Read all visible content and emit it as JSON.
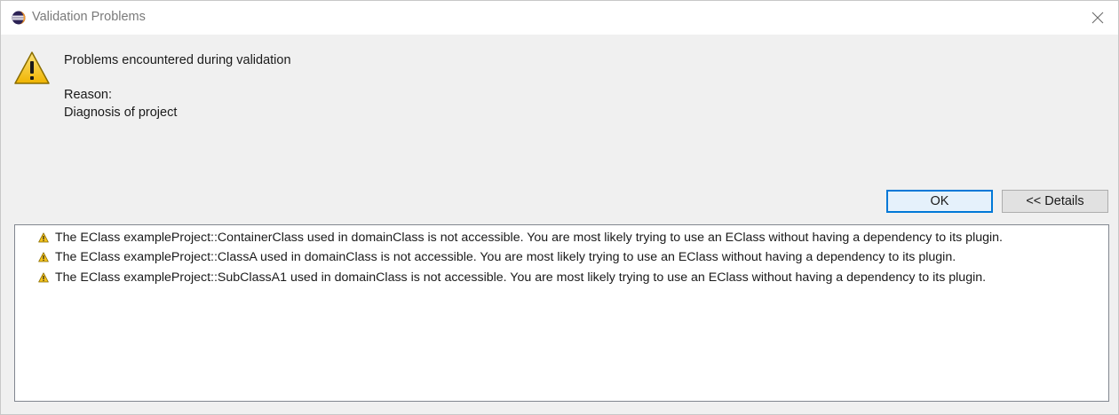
{
  "window": {
    "title": "Validation Problems",
    "close_label": "×"
  },
  "message": {
    "title": "Problems encountered during validation",
    "reason_label": "Reason:",
    "reason_detail": "Diagnosis of project",
    "icon": "warning-icon"
  },
  "buttons": {
    "ok_label": "OK",
    "details_label": "<< Details"
  },
  "details": {
    "items": [
      {
        "icon": "warning-icon",
        "text": "The EClass exampleProject::ContainerClass used in domainClass is not accessible. You are most likely trying to use an EClass without having a dependency to its plugin."
      },
      {
        "icon": "warning-icon",
        "text": "The EClass exampleProject::ClassA used in domainClass is not accessible. You are most likely trying to use an EClass without having a dependency to its plugin."
      },
      {
        "icon": "warning-icon",
        "text": "The EClass exampleProject::SubClassA1 used in domainClass is not accessible. You are most likely trying to use an EClass without having a dependency to its plugin."
      }
    ]
  },
  "colors": {
    "accent": "#0078d7",
    "warning_yellow": "#f4c21b",
    "dialog_bg": "#f0f0f0"
  }
}
